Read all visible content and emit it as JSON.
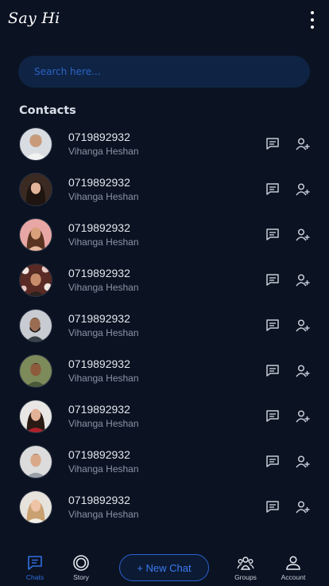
{
  "app": {
    "title": "Say Hi"
  },
  "search": {
    "placeholder": "Search here..."
  },
  "contacts": {
    "section_title": "Contacts",
    "items": [
      {
        "phone": "0719892932",
        "name": "Vihanga Heshan",
        "avatar": "avatar-man-light"
      },
      {
        "phone": "0719892932",
        "name": "Vihanga Heshan",
        "avatar": "avatar-woman-dark-hair"
      },
      {
        "phone": "0719892932",
        "name": "Vihanga Heshan",
        "avatar": "avatar-woman-pink"
      },
      {
        "phone": "0719892932",
        "name": "Vihanga Heshan",
        "avatar": "avatar-man-flowers"
      },
      {
        "phone": "0719892932",
        "name": "Vihanga Heshan",
        "avatar": "avatar-man-beard"
      },
      {
        "phone": "0719892932",
        "name": "Vihanga Heshan",
        "avatar": "avatar-man-smiling"
      },
      {
        "phone": "0719892932",
        "name": "Vihanga Heshan",
        "avatar": "avatar-woman-red"
      },
      {
        "phone": "0719892932",
        "name": "Vihanga Heshan",
        "avatar": "avatar-man-grey"
      },
      {
        "phone": "0719892932",
        "name": "Vihanga Heshan",
        "avatar": "avatar-woman-blonde"
      }
    ]
  },
  "bottom_nav": {
    "chats": "Chats",
    "story": "Story",
    "new_chat": "+ New Chat",
    "groups": "Groups",
    "account": "Account"
  },
  "colors": {
    "background": "#0b1221",
    "accent": "#2f6fe0",
    "search_bg": "#0f2445"
  }
}
